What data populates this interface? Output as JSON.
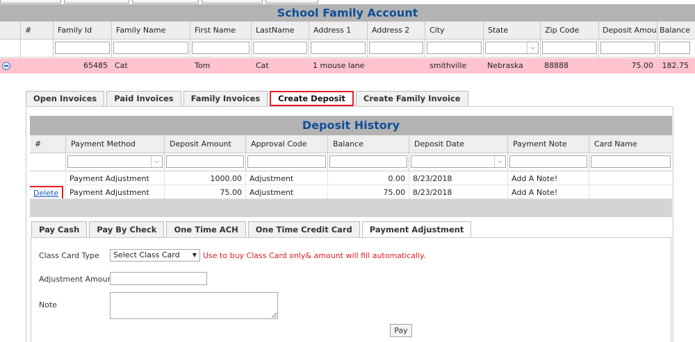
{
  "outer_grid": {
    "title": "School Family Account",
    "columns": [
      "#",
      "Family Id",
      "Family Name",
      "First Name",
      "LastName",
      "Address 1",
      "Address 2",
      "City",
      "State",
      "Zip Code",
      "Deposit Amount",
      "Balance"
    ],
    "row": {
      "family_id": "65485",
      "family_name": "Cat",
      "first_name": "Tom",
      "last_name": "Cat",
      "address1": "1 mouse lane",
      "address2": "",
      "city": "smithville",
      "state": "Nebraska",
      "zip": "88888",
      "deposit_amount": "75.00",
      "balance": "182.75"
    }
  },
  "detail_tabs": [
    "Open Invoices",
    "Paid Invoices",
    "Family Invoices",
    "Create Deposit",
    "Create Family Invoice"
  ],
  "deposit_history": {
    "title": "Deposit History",
    "columns": [
      "#",
      "Payment Method",
      "Deposit Amount",
      "Approval Code",
      "Balance",
      "Deposit Date",
      "Payment Note",
      "Card Name"
    ],
    "rows": [
      {
        "action": "",
        "method": "Payment Adjustment",
        "amount": "1000.00",
        "approval": "Adjustment",
        "balance": "0.00",
        "date": "8/23/2018",
        "note": "Add A Note!",
        "card": ""
      },
      {
        "action": "Delete",
        "method": "Payment Adjustment",
        "amount": "75.00",
        "approval": "Adjustment",
        "balance": "75.00",
        "date": "8/23/2018",
        "note": "Add A Note!",
        "card": ""
      }
    ]
  },
  "payment_tabs": [
    "Pay Cash",
    "Pay By Check",
    "One Time ACH",
    "One Time Credit Card",
    "Payment Adjustment"
  ],
  "form": {
    "class_card_label": "Class Card Type",
    "class_card_value": "Select Class Card",
    "class_card_hint": "Use to buy Class Card only& amount will fill automatically.",
    "amount_label": "Adjustment Amount",
    "note_label": "Note",
    "pay_label": "Pay"
  },
  "colors": {
    "title_text": "#0e4f97",
    "title_bar": "#b3b3b3",
    "selected_row": "#ffc3cf",
    "highlight_border": "#e41b23",
    "link": "#1a56c4"
  }
}
